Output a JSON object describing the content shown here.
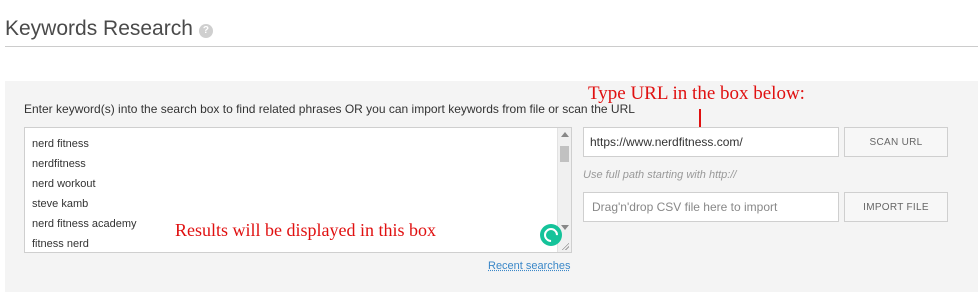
{
  "header": {
    "title": "Keywords Research",
    "help_glyph": "?"
  },
  "panel": {
    "instructions": "Enter keyword(s) into the search box to find related phrases OR you can import keywords from file or scan the URL",
    "results": [
      "nerd fitness",
      "nerdfitness",
      "nerd workout",
      "steve kamb",
      "nerd fitness academy",
      "fitness nerd"
    ],
    "recent_searches_label": "Recent searches",
    "url_input_value": "https://www.nerdfitness.com/",
    "scan_button_label": "SCAN URL",
    "url_hint": "Use full path starting with http://",
    "drop_placeholder": "Drag'n'drop CSV file here to import",
    "import_button_label": "IMPORT FILE"
  },
  "annotations": {
    "results_note": "Results will be displayed in this box",
    "url_note": "Type URL in the box below:"
  },
  "colors": {
    "annotation": "#e01010",
    "link": "#3a87c8",
    "grammarly": "#15c39a"
  }
}
